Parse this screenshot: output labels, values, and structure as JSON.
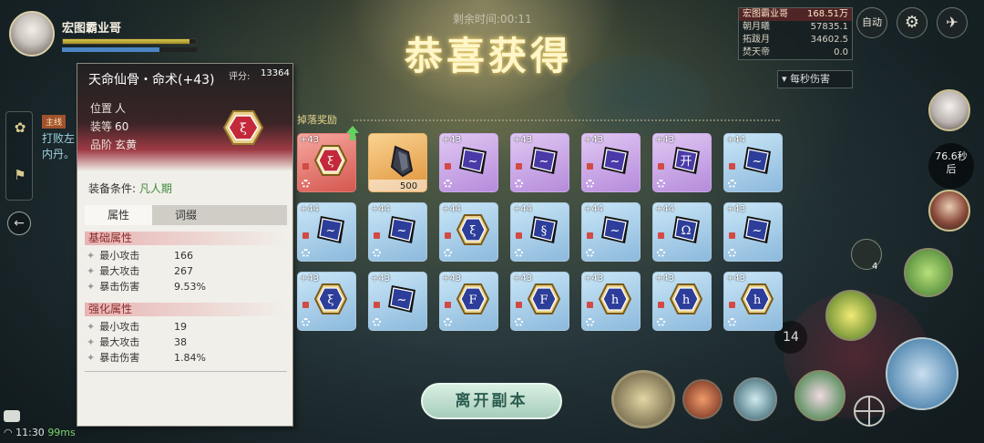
{
  "player": {
    "name": "宏图霸业哥",
    "hp_fraction": 0.95,
    "mp_fraction": 0.72
  },
  "quest": {
    "tag": "主线",
    "text": "打败左内丹。"
  },
  "status": {
    "time": "11:30",
    "ping": "99ms"
  },
  "timer": "剩余时间:00:11",
  "title": "恭喜获得",
  "tooltip": {
    "item_name": "天命仙骨・命术(+43)",
    "score_label": "评分:",
    "score": "13364",
    "position_label": "位置",
    "position_value": "人",
    "level_label": "装等",
    "level_value": "60",
    "grade_label": "品阶",
    "grade_value": "玄黄",
    "req_label": "装备条件:",
    "req_value": "凡人期",
    "tabs": [
      "属性",
      "词缀"
    ],
    "base_section": "基础属性",
    "base_stats": [
      {
        "name": "最小攻击",
        "value": "166"
      },
      {
        "name": "最大攻击",
        "value": "267"
      },
      {
        "name": "暴击伤害",
        "value": "9.53%"
      }
    ],
    "enhance_section": "强化属性",
    "enhance_stats": [
      {
        "name": "最小攻击",
        "value": "19"
      },
      {
        "name": "最大攻击",
        "value": "38"
      },
      {
        "name": "暴击伤害",
        "value": "1.84%"
      }
    ]
  },
  "damage_list": [
    {
      "name": "宏图霸业哥",
      "value": "168.51万"
    },
    {
      "name": "朝月曦",
      "value": "57835.1"
    },
    {
      "name": "拓跋月",
      "value": "34602.5"
    },
    {
      "name": "焚天帝",
      "value": "0.0"
    }
  ],
  "damage_toggle": "每秒伤害",
  "auto_label": "自动",
  "revive_timer": "76.6秒",
  "revive_suffix": "后",
  "potion_count": "4",
  "skill_cooldown": "14",
  "rewards_label": "掉落奖励",
  "rewards": [
    {
      "lvl": "+43",
      "color": "red",
      "glyph": "ξ",
      "qty": ""
    },
    {
      "lvl": "",
      "color": "orange",
      "glyph": "shard",
      "qty": "500"
    },
    {
      "lvl": "+43",
      "color": "purple",
      "glyph": "~",
      "qty": ""
    },
    {
      "lvl": "+43",
      "color": "purple",
      "glyph": "~",
      "qty": ""
    },
    {
      "lvl": "+43",
      "color": "purple",
      "glyph": "~",
      "qty": ""
    },
    {
      "lvl": "+43",
      "color": "purple",
      "glyph": "开",
      "qty": ""
    },
    {
      "lvl": "+44",
      "color": "blue",
      "glyph": "~",
      "qty": ""
    },
    {
      "lvl": "+44",
      "color": "blue",
      "glyph": "~",
      "qty": ""
    },
    {
      "lvl": "+44",
      "color": "blue",
      "glyph": "~",
      "qty": ""
    },
    {
      "lvl": "+44",
      "color": "blue",
      "glyph": "ξ",
      "qty": ""
    },
    {
      "lvl": "+44",
      "color": "blue",
      "glyph": "§",
      "qty": ""
    },
    {
      "lvl": "+44",
      "color": "blue",
      "glyph": "~",
      "qty": ""
    },
    {
      "lvl": "+44",
      "color": "blue",
      "glyph": "Ω",
      "qty": ""
    },
    {
      "lvl": "+43",
      "color": "blue",
      "glyph": "~",
      "qty": ""
    },
    {
      "lvl": "+43",
      "color": "blue",
      "glyph": "ξ",
      "qty": ""
    },
    {
      "lvl": "+43",
      "color": "blue",
      "glyph": "~",
      "qty": ""
    },
    {
      "lvl": "+43",
      "color": "blue",
      "glyph": "F",
      "qty": ""
    },
    {
      "lvl": "+43",
      "color": "blue",
      "glyph": "F",
      "qty": ""
    },
    {
      "lvl": "+43",
      "color": "blue",
      "glyph": "h",
      "qty": ""
    },
    {
      "lvl": "+43",
      "color": "blue",
      "glyph": "h",
      "qty": ""
    },
    {
      "lvl": "+43",
      "color": "blue",
      "glyph": "h",
      "qty": ""
    }
  ],
  "exit_button": "离开副本"
}
